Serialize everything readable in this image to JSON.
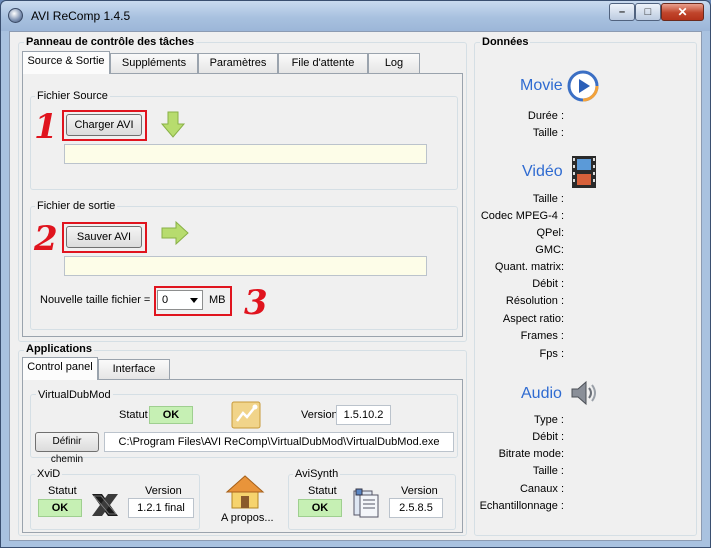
{
  "window": {
    "title": "AVI ReComp  1.4.5"
  },
  "task_panel": {
    "title": "Panneau de contrôle des tâches",
    "tabs": [
      "Source & Sortie",
      "Suppléments",
      "Paramètres",
      "File d'attente",
      "Log"
    ],
    "source_group": "Fichier Source",
    "load_button": "Charger AVI",
    "source_path": "",
    "output_group": "Fichier de sortie",
    "save_button": "Sauver AVI",
    "output_path": "",
    "new_size_label": "Nouvelle taille fichier =",
    "new_size_value": "0",
    "new_size_unit": "MB"
  },
  "annotations": {
    "one": "1",
    "two": "2",
    "three": "3"
  },
  "applications": {
    "title": "Applications",
    "tabs": [
      "Control panel",
      "Interface"
    ],
    "vdm": {
      "group": "VirtualDubMod",
      "status_label": "Statut",
      "status": "OK",
      "version_label": "Version",
      "version": "1.5.10.2",
      "path_button": "Définir chemin",
      "path": "C:\\Program Files\\AVI ReComp\\VirtualDubMod\\VirtualDubMod.exe"
    },
    "xvid": {
      "group": "XviD",
      "status_label": "Statut",
      "status": "OK",
      "version_label": "Version",
      "version": "1.2.1 final"
    },
    "about": {
      "label": "A propos..."
    },
    "avisynth": {
      "group": "AviSynth",
      "status_label": "Statut",
      "status": "OK",
      "version_label": "Version",
      "version": "2.5.8.5"
    }
  },
  "data_panel": {
    "title": "Données",
    "movie": {
      "heading": "Movie",
      "fields": [
        "Durée :",
        "Taille :"
      ]
    },
    "video": {
      "heading": "Vidéo",
      "fields": [
        "Taille :",
        "Codec MPEG-4 :",
        "QPel:",
        "GMC:",
        "Quant. matrix:",
        "Débit :",
        "Résolution :",
        "Aspect ratio:",
        "Frames :",
        "Fps :"
      ]
    },
    "audio": {
      "heading": "Audio",
      "fields": [
        "Type :",
        "Débit :",
        "Bitrate mode:",
        "Taille :",
        "Canaux :",
        "Echantillonnage :"
      ]
    }
  },
  "icons": {
    "app": "app-icon",
    "arrow_down": "green-arrow-down-icon",
    "arrow_right": "green-arrow-right-icon",
    "vdm": "virtualdubmod-icon",
    "xvid": "xvid-icon",
    "about": "house-icon",
    "avisynth": "avisynth-icon",
    "movie": "play-icon",
    "video": "film-icon",
    "audio": "speaker-icon"
  },
  "colors": {
    "accent_heading": "#2f6bd1",
    "annotation": "#e0141e",
    "ok_badge": "#c6f0b4",
    "path_field": "#fdfde8"
  }
}
